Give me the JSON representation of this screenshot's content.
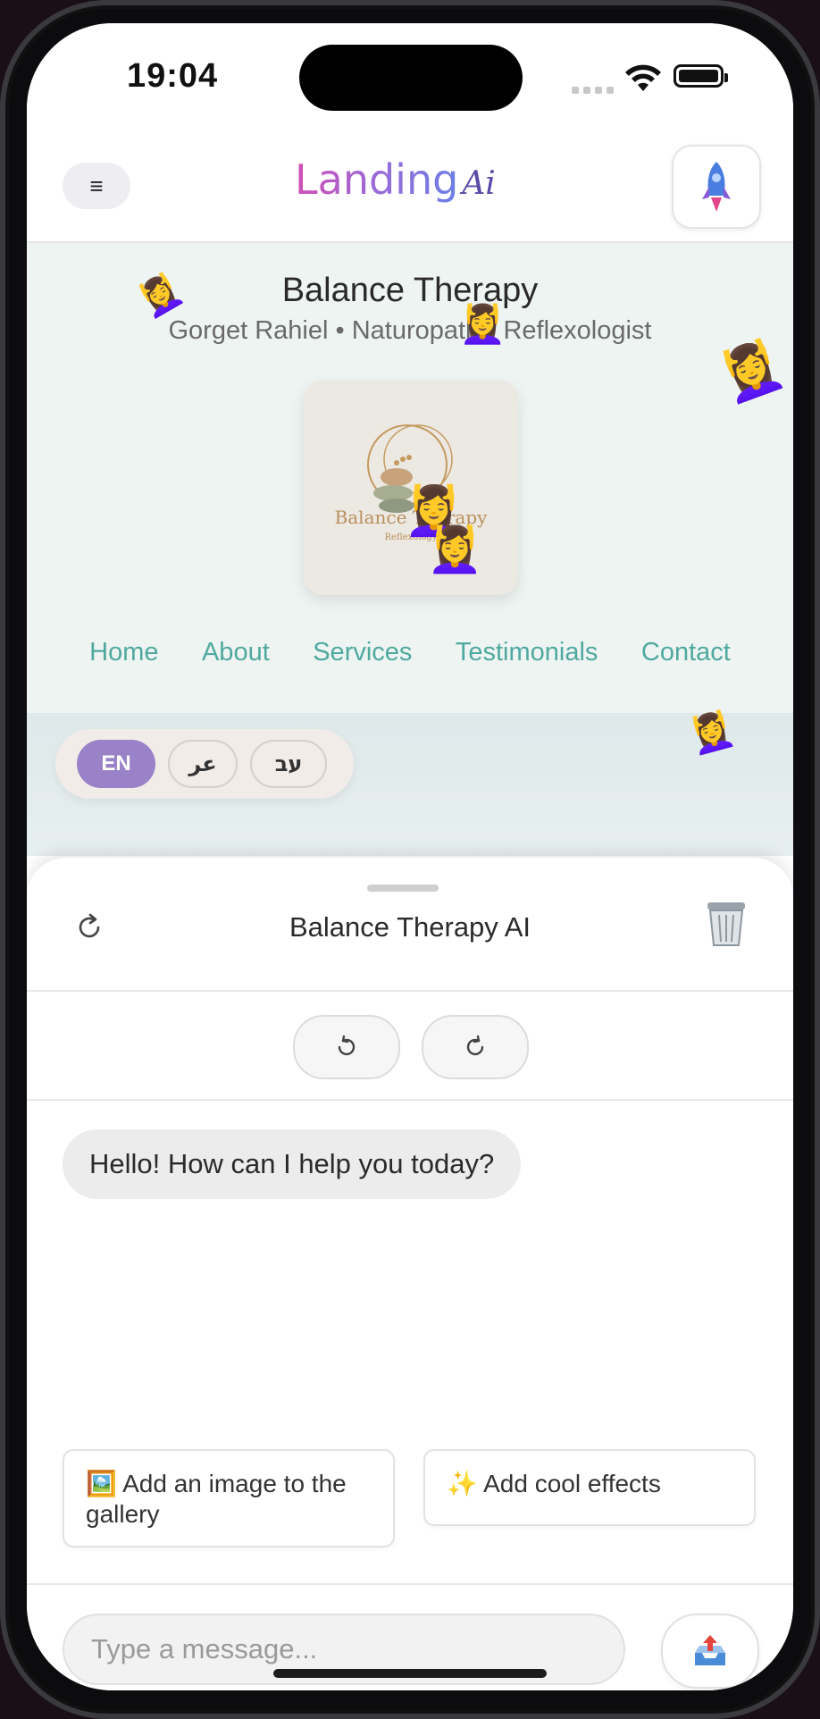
{
  "status_bar": {
    "time": "19:04"
  },
  "header": {
    "logo_main": "Landing",
    "logo_ai": "Ai",
    "menu_icon": "≡",
    "rocket_icon": "rocket-icon"
  },
  "hero": {
    "business_name": "Balance Therapy",
    "subtitle": "Gorget Rahiel • Naturopath • Reflexologist",
    "logo_text_1": "Balance Therapy",
    "logo_text_2": "Reflexology",
    "nav": [
      "Home",
      "About",
      "Services",
      "Testimonials",
      "Contact"
    ]
  },
  "languages": {
    "en": "EN",
    "ar": "عر",
    "he": "עב"
  },
  "effects": {
    "emoji": "💆‍♀️"
  },
  "chat": {
    "title": "Balance Therapy AI",
    "greeting": "Hello! How can I help you today?",
    "suggestions": [
      {
        "emoji": "🖼️",
        "text": "Add an image to the gallery"
      },
      {
        "emoji": "✨",
        "text": "Add cool effects"
      }
    ],
    "input_placeholder": "Type a message..."
  },
  "colors": {
    "accent_purple": "#9a82c8",
    "nav_teal": "#4fa9a0",
    "hero_bg": "#eef4f1"
  }
}
